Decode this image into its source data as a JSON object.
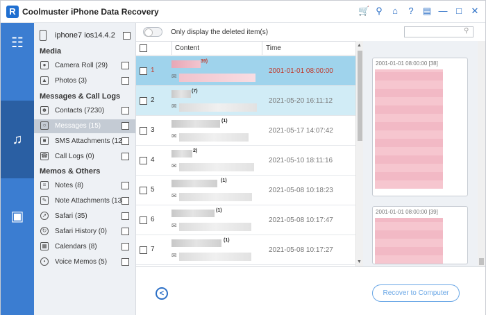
{
  "app": {
    "logo_letter": "R",
    "title": "Coolmuster iPhone Data Recovery",
    "titlebar_icons": [
      "cart-icon",
      "key-icon",
      "home-icon",
      "help-icon",
      "feedback-icon",
      "minimize-icon",
      "maximize-icon",
      "close-icon"
    ]
  },
  "rail": {
    "items": [
      {
        "name": "device-recovery-icon",
        "active": false
      },
      {
        "name": "music-sync-icon",
        "active": true
      },
      {
        "name": "toolbox-icon",
        "active": false
      }
    ]
  },
  "tree": {
    "device": "iphone7 ios14.4.2",
    "sections": {
      "media": "Media",
      "messages_calls": "Messages & Call Logs",
      "memos_others": "Memos & Others"
    },
    "items": {
      "camera_roll": "Camera Roll  (29)",
      "photos": "Photos  (3)",
      "contacts": "Contacts  (7230)",
      "messages": "Messages  (15)",
      "sms_attachments": "SMS Attachments  (12)",
      "call_logs": "Call Logs  (0)",
      "notes": "Notes  (8)",
      "note_attachments": "Note Attachments  (13)",
      "safari": "Safari  (35)",
      "safari_history": "Safari History  (0)",
      "calendars": "Calendars  (8)",
      "voice_memos": "Voice Memos  (5)"
    }
  },
  "toolbar": {
    "toggle_label": "Only display the deleted item(s)",
    "search_placeholder": ""
  },
  "table": {
    "headers": {
      "content": "Content",
      "time": "Time"
    },
    "rows": [
      {
        "num": "1",
        "count": "39)",
        "time": "2001-01-01 08:00:00"
      },
      {
        "num": "2",
        "count": "(7)",
        "time": "2021-05-20 16:11:12"
      },
      {
        "num": "3",
        "count": "(1)",
        "time": "2021-05-17 14:07:42"
      },
      {
        "num": "4",
        "count": "2)",
        "time": "2021-05-10 18:11:16"
      },
      {
        "num": "5",
        "count": "(1)",
        "time": "2021-05-08 10:18:23"
      },
      {
        "num": "6",
        "count": "(1)",
        "time": "2021-05-08 10:17:47"
      },
      {
        "num": "7",
        "count": "(1)",
        "time": "2021-05-08 10:17:27"
      }
    ]
  },
  "preview": {
    "bubbles": [
      {
        "head": "2001-01-01 08:00:00   [38]"
      },
      {
        "head": "2001-01-01 08:00:00   [39]"
      }
    ]
  },
  "footer": {
    "recover_label": "Recover to Computer"
  }
}
